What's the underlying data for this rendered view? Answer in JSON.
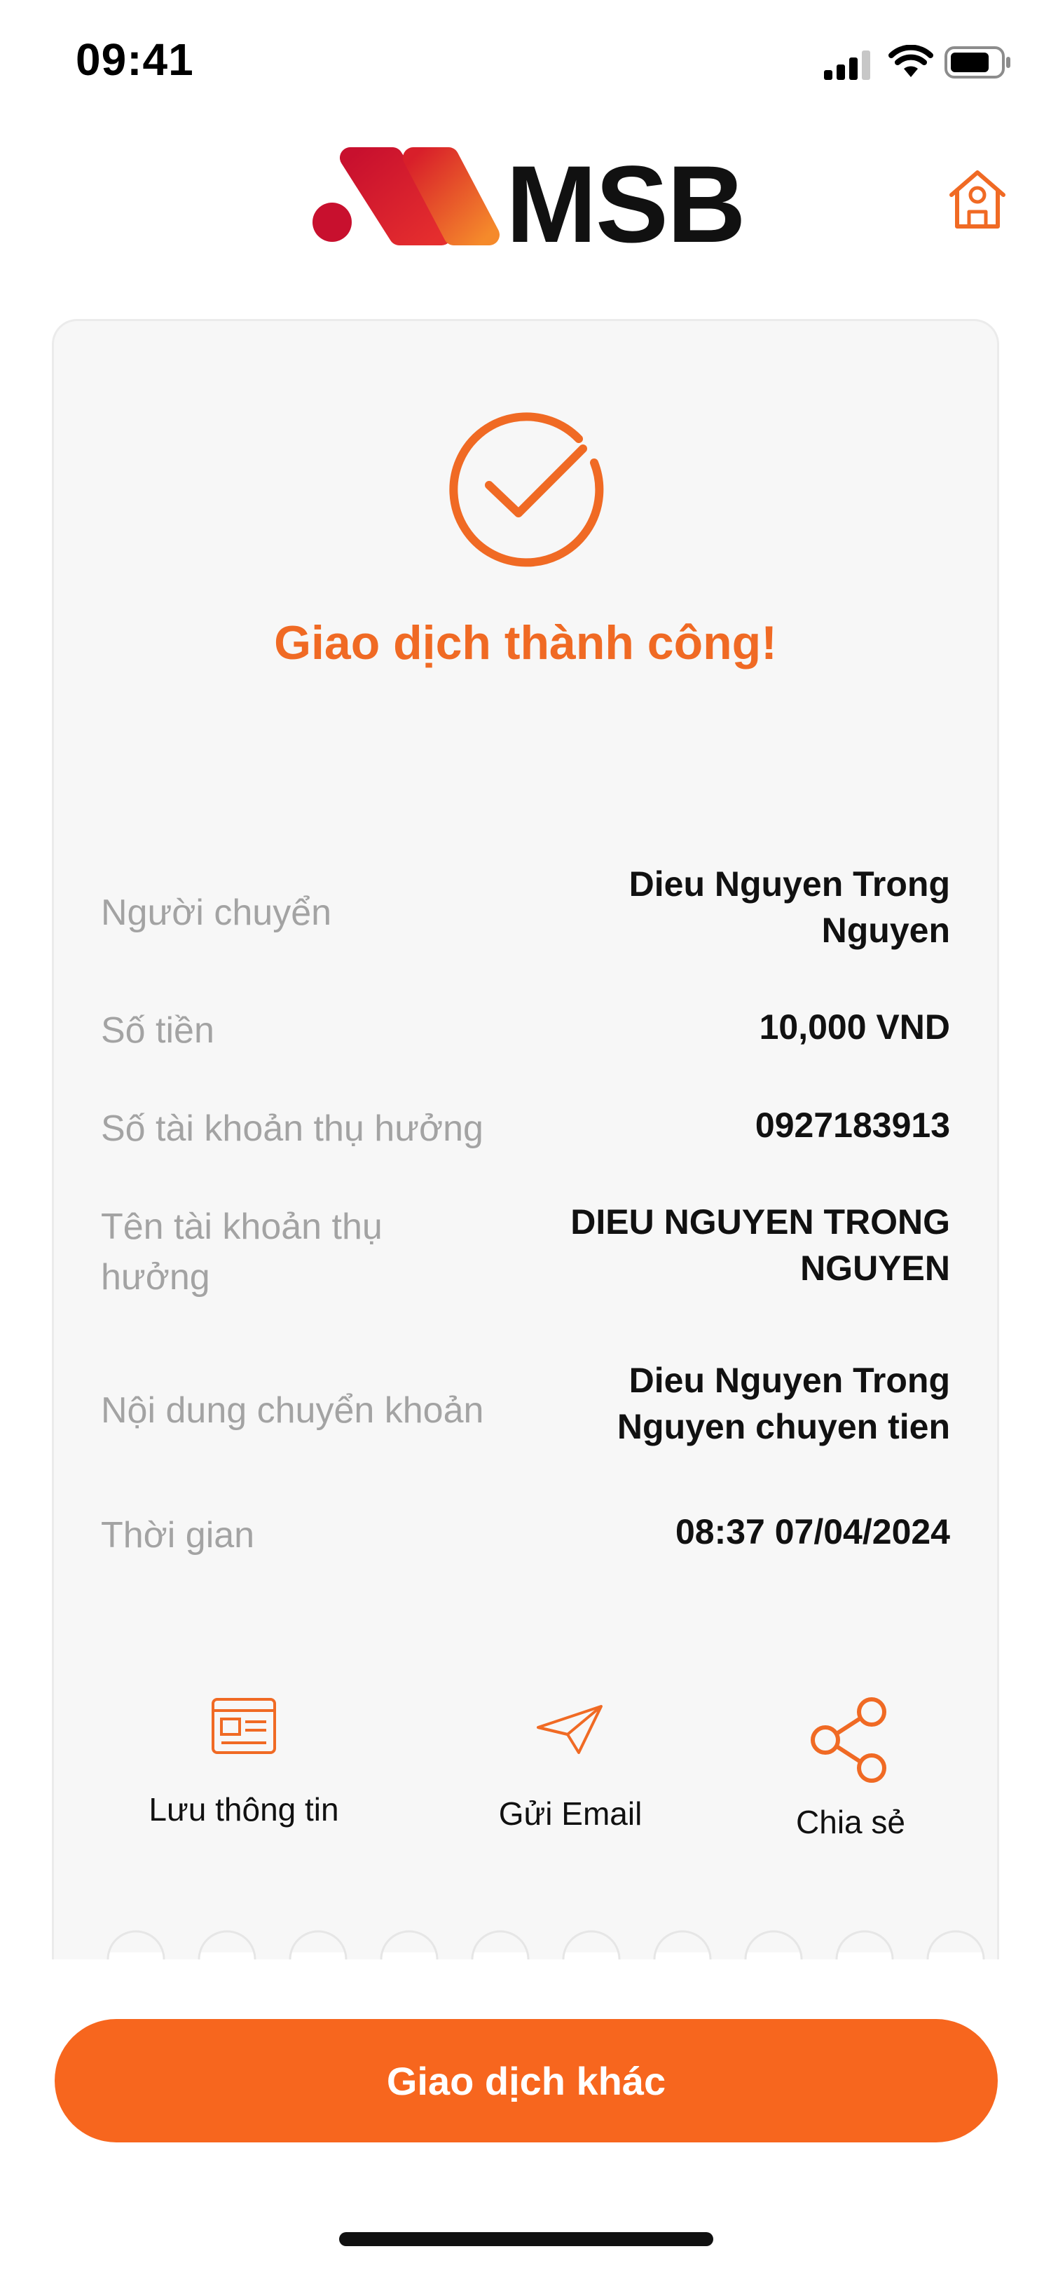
{
  "status_bar": {
    "time": "09:41"
  },
  "header": {
    "brand": "MSB"
  },
  "result": {
    "title": "Giao dịch thành công!"
  },
  "details": [
    {
      "label": "Người chuyển",
      "value": "Dieu Nguyen Trong Nguyen"
    },
    {
      "label": "Số tiền",
      "value": "10,000 VND"
    },
    {
      "label": "Số tài khoản thụ hưởng",
      "value": "0927183913"
    },
    {
      "label": "Tên tài khoản thụ hưởng",
      "value": "DIEU NGUYEN TRONG NGUYEN"
    },
    {
      "label": "Nội dung chuyển khoản",
      "value": "Dieu Nguyen Trong Nguyen chuyen tien"
    },
    {
      "label": "Thời gian",
      "value": "08:37 07/04/2024"
    }
  ],
  "actions": {
    "save_label": "Lưu thông tin",
    "email_label": "Gửi Email",
    "share_label": "Chia sẻ"
  },
  "cta": {
    "label": "Giao dịch khác"
  },
  "colors": {
    "accent": "#f06a24",
    "button": "#f7661e",
    "label": "#a3a3a3"
  },
  "icons": [
    "signal-icon",
    "wifi-icon",
    "battery-icon",
    "msb-logo",
    "home-icon",
    "success-check-icon",
    "id-card-icon",
    "paper-plane-icon",
    "share-icon"
  ]
}
